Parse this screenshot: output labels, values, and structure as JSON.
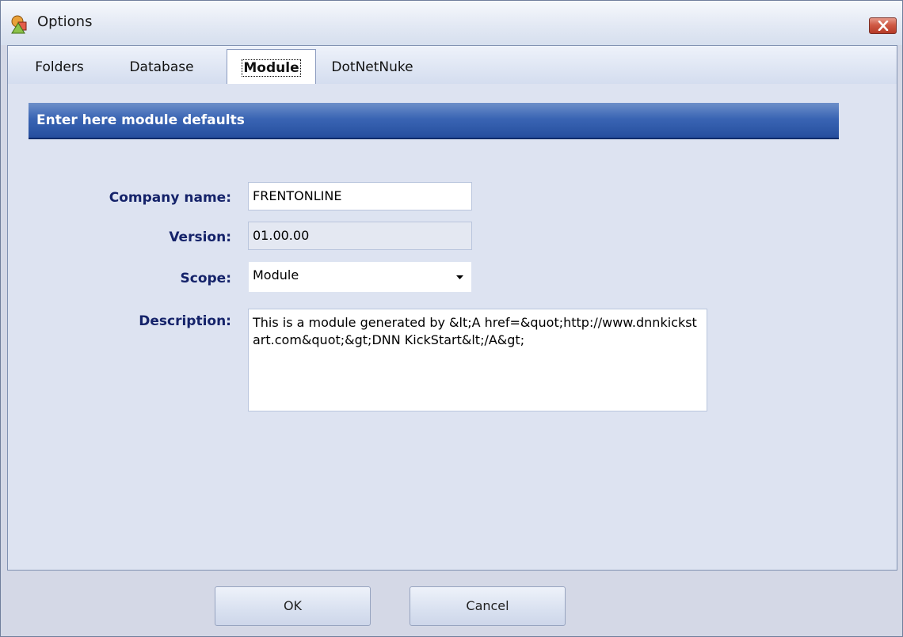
{
  "window": {
    "title": "Options"
  },
  "tabs": [
    {
      "label": "Folders"
    },
    {
      "label": "Database"
    },
    {
      "label": "Module"
    },
    {
      "label": "DotNetNuke"
    }
  ],
  "module": {
    "header": "Enter here module defaults",
    "company_label": "Company name:",
    "company_value": "FRENTONLINE",
    "version_label": "Version:",
    "version_value": "01.00.00",
    "scope_label": "Scope:",
    "scope_value": "Module",
    "description_label": "Description:",
    "description_value": "This is a module generated by &lt;A href=&quot;http://www.dnnkickstart.com&quot;&gt;DNN KickStart&lt;/A&gt;"
  },
  "buttons": {
    "ok": "OK",
    "cancel": "Cancel"
  },
  "colors": {
    "header_band": "#2f5aab",
    "label_text": "#15236a",
    "close_button": "#c94a35"
  }
}
